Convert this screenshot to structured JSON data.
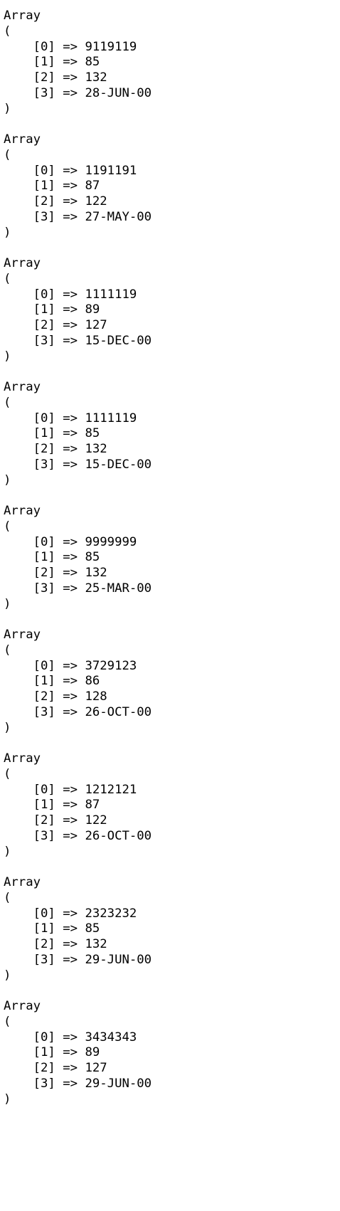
{
  "array_keyword": "Array",
  "open_paren": "(",
  "close_paren": ")",
  "arrow": "=>",
  "arrays": [
    {
      "values": [
        "9119119",
        "85",
        "132",
        "28-JUN-00"
      ]
    },
    {
      "values": [
        "1191191",
        "87",
        "122",
        "27-MAY-00"
      ]
    },
    {
      "values": [
        "1111119",
        "89",
        "127",
        "15-DEC-00"
      ]
    },
    {
      "values": [
        "1111119",
        "85",
        "132",
        "15-DEC-00"
      ]
    },
    {
      "values": [
        "9999999",
        "85",
        "132",
        "25-MAR-00"
      ]
    },
    {
      "values": [
        "3729123",
        "86",
        "128",
        "26-OCT-00"
      ]
    },
    {
      "values": [
        "1212121",
        "87",
        "122",
        "26-OCT-00"
      ]
    },
    {
      "values": [
        "2323232",
        "85",
        "132",
        "29-JUN-00"
      ]
    },
    {
      "values": [
        "3434343",
        "89",
        "127",
        "29-JUN-00"
      ]
    }
  ]
}
